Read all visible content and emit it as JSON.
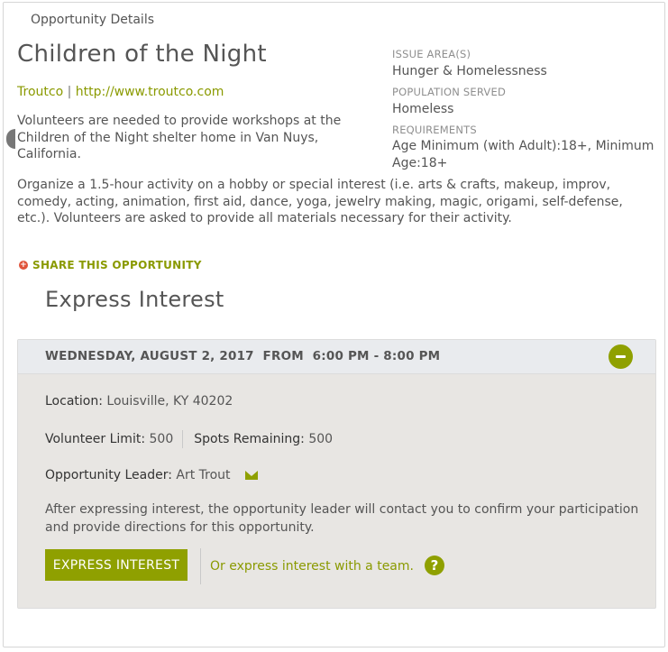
{
  "header": {
    "label": "Opportunity Details"
  },
  "opportunity": {
    "title": "Children of the Night",
    "org_name": "Troutco",
    "org_separator": "|",
    "org_url": "http://www.troutco.com",
    "description_1": "Volunteers are needed to provide workshops at the Children of the Night shelter home in Van Nuys, California.",
    "description_2": "Organize a 1.5-hour activity on a hobby or special interest (i.e. arts & crafts, makeup, improv, comedy, acting, animation, first aid, dance, yoga, jewelry making, magic, origami, self-defense, etc.). Volunteers are asked to provide all materials necessary for their activity."
  },
  "meta": {
    "issue_label": "ISSUE AREA(S)",
    "issue_value": "Hunger & Homelessness",
    "population_label": "POPULATION SERVED",
    "population_value": "Homeless",
    "requirements_label": "REQUIREMENTS",
    "requirements_value": "Age Minimum (with Adult):18+, Minimum Age:18+"
  },
  "share": {
    "icon": "plus-circle-icon",
    "label": "SHARE THIS OPPORTUNITY"
  },
  "express": {
    "title": "Express Interest",
    "date_header": "WEDNESDAY, AUGUST 2, 2017  FROM  6:00 PM - 8:00 PM",
    "location_label": "Location:",
    "location_value": "Louisville, KY 40202",
    "limit_label": "Volunteer Limit:",
    "limit_value": "500",
    "spots_label": "Spots Remaining:",
    "spots_value": "500",
    "leader_label": "Opportunity Leader:",
    "leader_value": "Art Trout",
    "note": "After expressing interest, the opportunity leader will contact you to confirm your participation and provide directions for this opportunity.",
    "button_label": "EXPRESS INTEREST",
    "team_link": "Or express interest with a team.",
    "help_glyph": "?"
  },
  "colors": {
    "accent": "#8fa000",
    "link": "#8a9a00",
    "share_icon": "#e0533a",
    "panel_bg": "#e8e6e3"
  }
}
